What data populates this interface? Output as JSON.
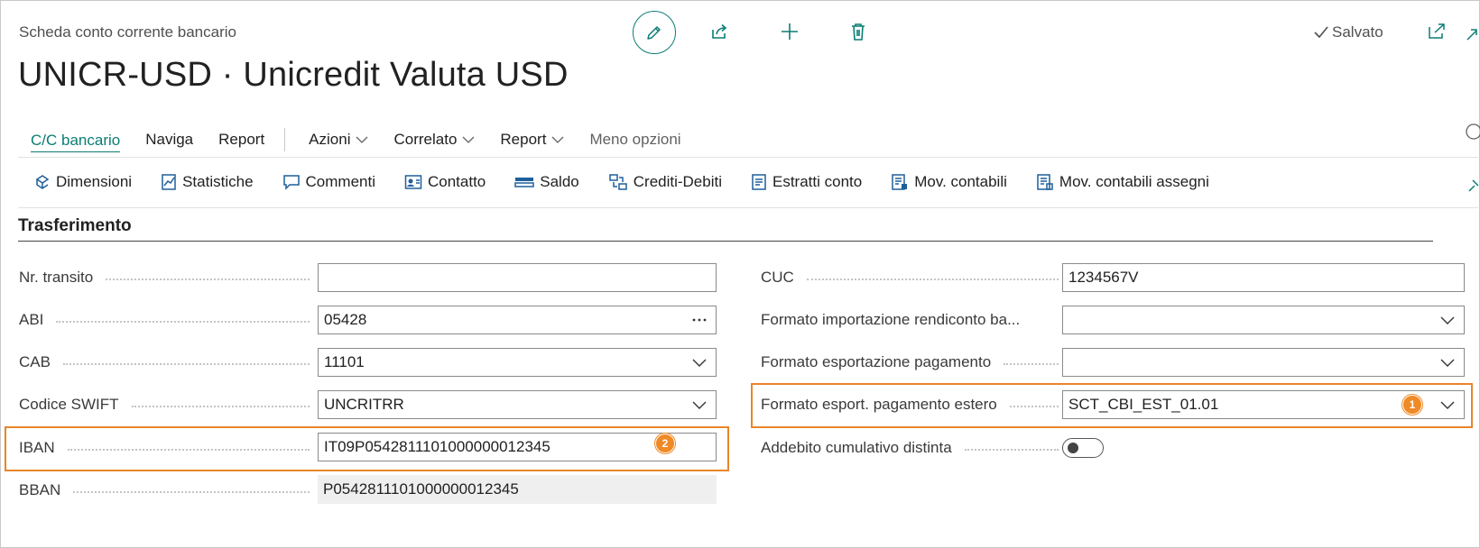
{
  "header": {
    "caption": "Scheda conto corrente bancario",
    "title": "UNICR-USD · Unicredit Valuta USD",
    "saved_label": "Salvato"
  },
  "menu": {
    "items": [
      {
        "label": "C/C bancario",
        "active": true
      },
      {
        "label": "Naviga"
      },
      {
        "label": "Report"
      },
      {
        "label": "Azioni",
        "dropdown": true
      },
      {
        "label": "Correlato",
        "dropdown": true
      },
      {
        "label": "Report",
        "dropdown": true
      },
      {
        "label": "Meno opzioni"
      }
    ]
  },
  "actions": [
    {
      "label": "Dimensioni",
      "icon": "dimensions-icon"
    },
    {
      "label": "Statistiche",
      "icon": "statistics-icon"
    },
    {
      "label": "Commenti",
      "icon": "comments-icon"
    },
    {
      "label": "Contatto",
      "icon": "contact-icon"
    },
    {
      "label": "Saldo",
      "icon": "balance-icon"
    },
    {
      "label": "Crediti-Debiti",
      "icon": "credit-debit-icon"
    },
    {
      "label": "Estratti conto",
      "icon": "statement-icon"
    },
    {
      "label": "Mov. contabili",
      "icon": "ledger-entries-icon"
    },
    {
      "label": "Mov. contabili assegni",
      "icon": "check-ledger-icon"
    }
  ],
  "section": {
    "title": "Trasferimento"
  },
  "left_fields": [
    {
      "label": "Nr. transito",
      "value": ""
    },
    {
      "label": "ABI",
      "value": "05428"
    },
    {
      "label": "CAB",
      "value": "11101"
    },
    {
      "label": "Codice SWIFT",
      "value": "UNCRITRR"
    },
    {
      "label": "IBAN",
      "value": "IT09P0542811101000000012345",
      "badge": "2"
    },
    {
      "label": "BBAN",
      "value": "P0542811101000000012345"
    }
  ],
  "right_fields": [
    {
      "label": "CUC",
      "value": "1234567V"
    },
    {
      "label": "Formato importazione rendiconto ba...",
      "value": ""
    },
    {
      "label": "Formato esportazione pagamento",
      "value": ""
    },
    {
      "label": "Formato esport. pagamento estero",
      "value": "SCT_CBI_EST_01.01",
      "badge": "1"
    },
    {
      "label": "Addebito cumulativo distinta",
      "value": "off"
    }
  ],
  "colors": {
    "accent": "#0a7d74",
    "highlight": "#e8852a",
    "badge": "#ef8a26"
  }
}
